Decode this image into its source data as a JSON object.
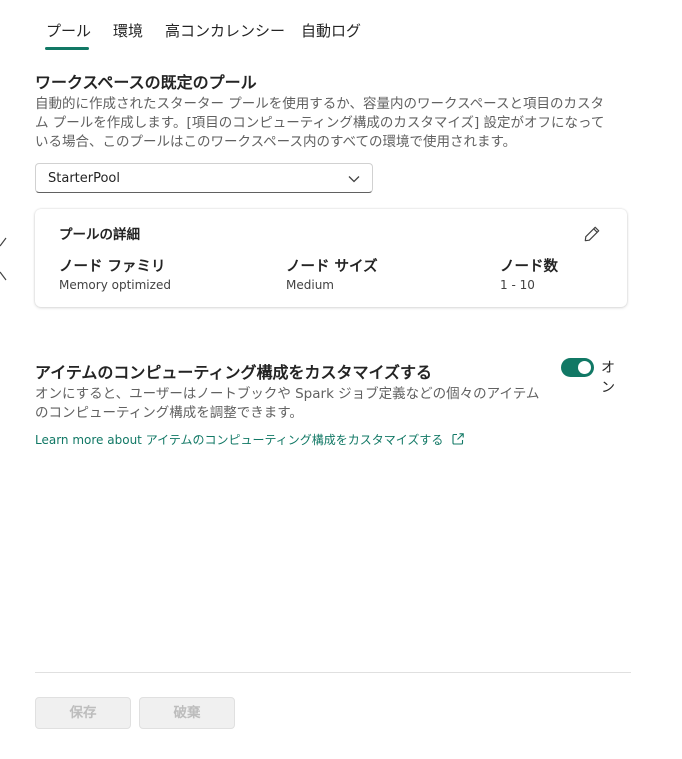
{
  "tabs": [
    {
      "label": "プール",
      "active": true
    },
    {
      "label": "環境",
      "active": false
    },
    {
      "label": "高コンカレンシー",
      "active": false
    },
    {
      "label": "自動ログ",
      "active": false
    }
  ],
  "pool_section": {
    "title": "ワークスペースの既定のプール",
    "description_lines": [
      "自動的に作成されたスターター プールを使用するか、容量内のワークスペースと項目のカスタ",
      "ム プールを作成します。[項目のコンピューティング構成のカスタマイズ] 設定がオフになって",
      "いる場合、このプールはこのワークスペース内のすべての環境で使用されます。"
    ],
    "dropdown_value": "StarterPool",
    "chevron_icon": "chevron-down-icon"
  },
  "pool_details": {
    "title": "プールの詳細",
    "edit_icon": "pencil-icon",
    "columns": [
      {
        "header": "ノード ファミリ",
        "value": "Memory optimized"
      },
      {
        "header": "ノード サイズ",
        "value": "Medium"
      },
      {
        "header": "ノード数",
        "value": "1 - 10"
      }
    ]
  },
  "customize_section": {
    "title": "アイテムのコンピューティング構成をカスタマイズする",
    "description_lines": [
      "オンにすると、ユーザーはノートブックや Spark ジョブ定義などの個々のアイテム",
      "のコンピューティング構成を調整できます。"
    ],
    "toggle_on": true,
    "toggle_label": "オン",
    "learn_more_link": "Learn more about アイテムのコンピューティング構成をカスタマイズする",
    "external_link_icon": "external-link-icon"
  },
  "footer": {
    "save_label": "保存",
    "discard_label": "破棄"
  },
  "colors": {
    "accent": "#117865",
    "text": "#242424",
    "secondary_text": "#616161",
    "disabled_bg": "#f0f0f0",
    "disabled_text": "#bdbdbd"
  }
}
